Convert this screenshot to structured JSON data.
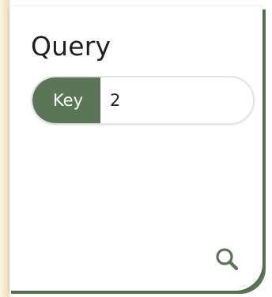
{
  "query_card": {
    "title": "Query",
    "key_field": {
      "label": "Key",
      "value": "2"
    },
    "search_button": {
      "icon": "search-icon"
    }
  },
  "colors": {
    "accent": "#5b7557",
    "side_strip": "#f3e4c4"
  }
}
